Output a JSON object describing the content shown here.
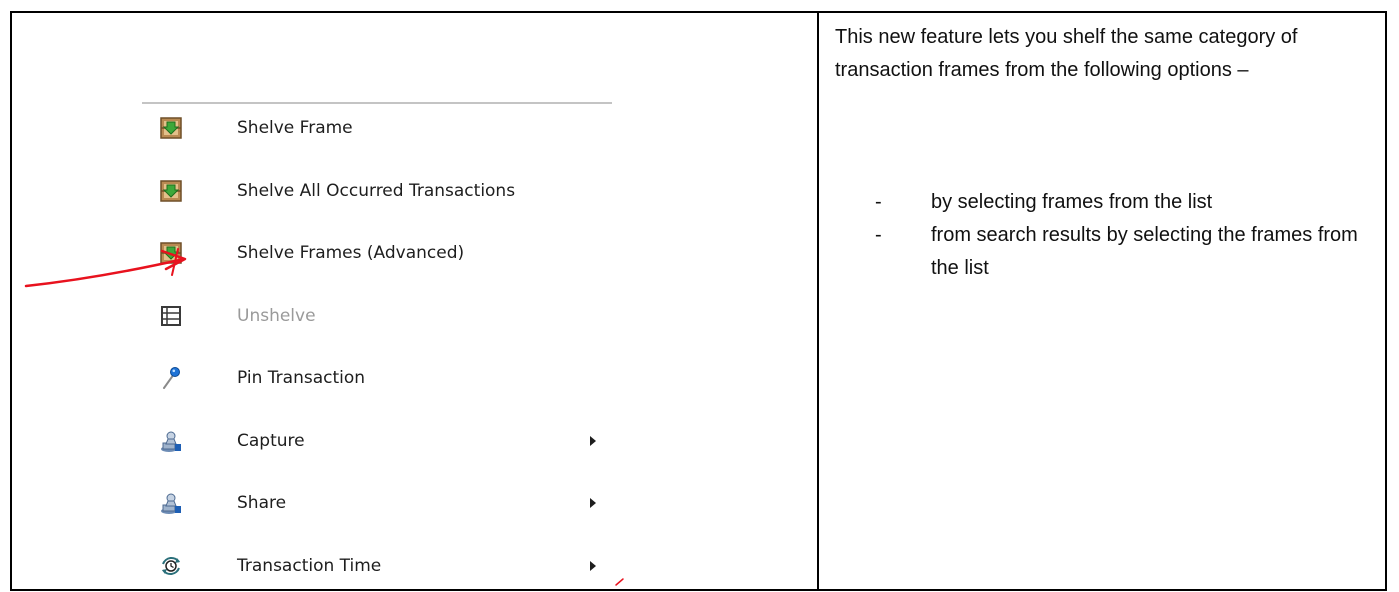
{
  "menu": {
    "items": [
      {
        "label": "Shelve Frame",
        "icon": "shelve-frame-icon",
        "disabled": false,
        "submenu": false
      },
      {
        "label": "Shelve All Occurred Transactions",
        "icon": "shelve-all-icon",
        "disabled": false,
        "submenu": false
      },
      {
        "label": "Shelve Frames (Advanced)",
        "icon": "shelve-advanced-icon",
        "disabled": false,
        "submenu": false
      },
      {
        "label": "Unshelve",
        "icon": "unshelve-icon",
        "disabled": true,
        "submenu": false
      },
      {
        "label": "Pin Transaction",
        "icon": "pin-icon",
        "disabled": false,
        "submenu": false
      },
      {
        "label": "Capture",
        "icon": "capture-icon",
        "disabled": false,
        "submenu": true
      },
      {
        "label": "Share",
        "icon": "share-icon",
        "disabled": false,
        "submenu": true
      },
      {
        "label": "Transaction Time",
        "icon": "transaction-time-icon",
        "disabled": false,
        "submenu": true
      }
    ]
  },
  "description": {
    "intro": "This new feature lets you shelf the same category of transaction frames from the following options –",
    "bullet_marker": "-",
    "bullets": [
      "by selecting frames from the list",
      "from search results by selecting the frames from the list"
    ]
  },
  "colors": {
    "annotation": "#e8121e",
    "separator": "#c4c4c4",
    "disabled_text": "#9a9a9a"
  }
}
